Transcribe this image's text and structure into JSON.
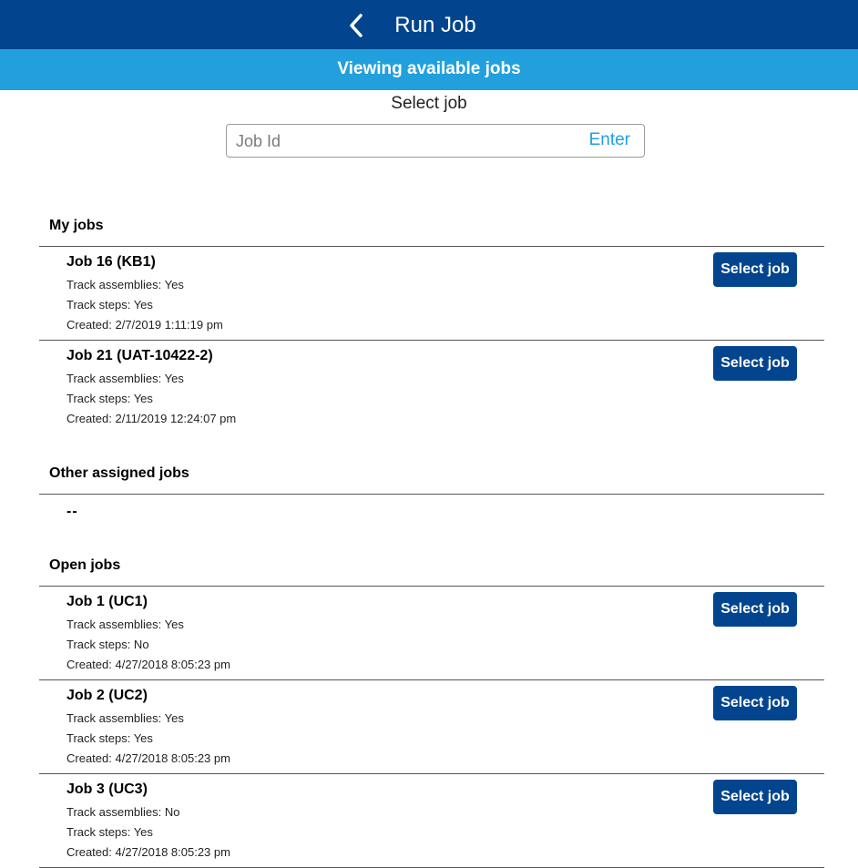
{
  "header": {
    "title": "Run Job",
    "back_icon": "chevron-left-icon"
  },
  "subheader": {
    "text": "Viewing available jobs"
  },
  "select": {
    "heading": "Select job",
    "input_placeholder": "Job Id",
    "input_value": "",
    "enter_label": "Enter"
  },
  "colors": {
    "primary": "#02458e",
    "accent": "#22a0dd"
  },
  "sections": {
    "my_jobs": {
      "title": "My jobs",
      "jobs": [
        {
          "title": "Job 16 (KB1)",
          "track_assemblies": "Track assemblies: Yes",
          "track_steps": "Track steps: Yes",
          "created": "Created: 2/7/2019 1:11:19 pm",
          "button": "Select job"
        },
        {
          "title": "Job 21 (UAT-10422-2)",
          "track_assemblies": "Track assemblies: Yes",
          "track_steps": "Track steps: Yes",
          "created": "Created: 2/11/2019 12:24:07 pm",
          "button": "Select job"
        }
      ]
    },
    "other_assigned": {
      "title": "Other assigned jobs",
      "empty_text": "--"
    },
    "open_jobs": {
      "title": "Open jobs",
      "jobs": [
        {
          "title": "Job 1 (UC1)",
          "track_assemblies": "Track assemblies: Yes",
          "track_steps": "Track steps: No",
          "created": "Created: 4/27/2018 8:05:23 pm",
          "button": "Select job"
        },
        {
          "title": "Job 2 (UC2)",
          "track_assemblies": "Track assemblies: Yes",
          "track_steps": "Track steps: Yes",
          "created": "Created: 4/27/2018 8:05:23 pm",
          "button": "Select job"
        },
        {
          "title": "Job 3 (UC3)",
          "track_assemblies": "Track assemblies: No",
          "track_steps": "Track steps: Yes",
          "created": "Created: 4/27/2018 8:05:23 pm",
          "button": "Select job"
        }
      ]
    }
  }
}
